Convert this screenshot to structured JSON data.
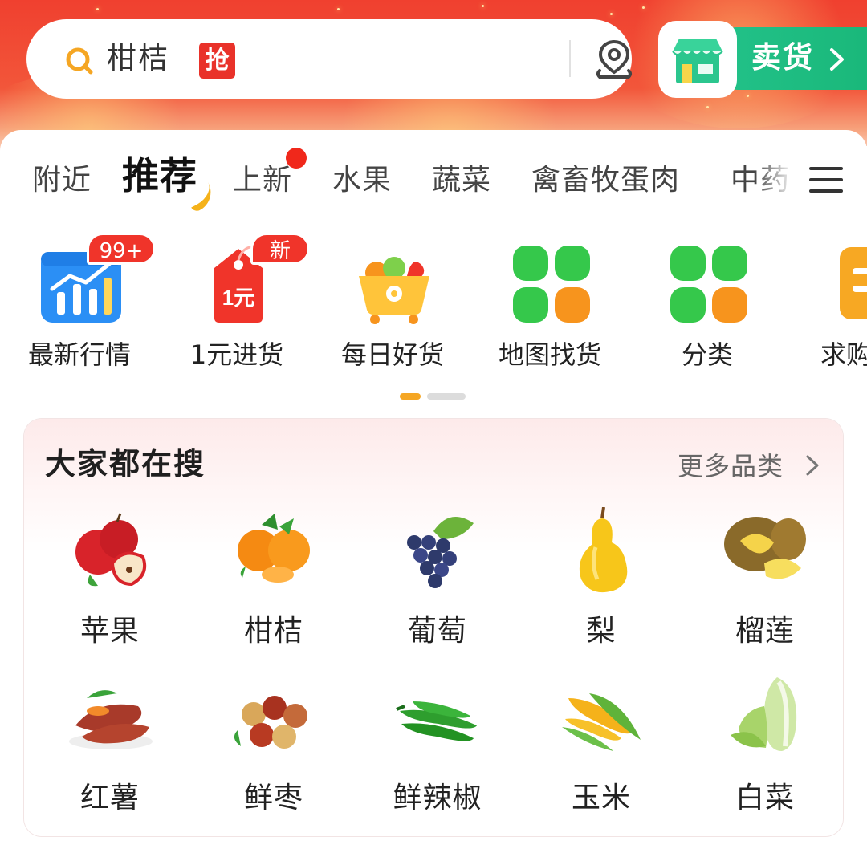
{
  "header": {
    "search": {
      "text": "柑桔",
      "badge": "抢"
    },
    "sell_button": {
      "label": "卖货"
    }
  },
  "tabs": [
    {
      "label": "附近",
      "active": false,
      "dot": false
    },
    {
      "label": "推荐",
      "active": true,
      "dot": false
    },
    {
      "label": "上新",
      "active": false,
      "dot": true
    },
    {
      "label": "水果",
      "active": false,
      "dot": false
    },
    {
      "label": "蔬菜",
      "active": false,
      "dot": false
    },
    {
      "label": "禽畜牧蛋肉",
      "active": false,
      "dot": false
    },
    {
      "label": "中药",
      "active": false,
      "dot": false
    }
  ],
  "quick_links": [
    {
      "label": "最新行情",
      "badge": "99+",
      "icon": "chart-icon"
    },
    {
      "label": "1元进货",
      "badge": "新",
      "icon": "price-tag-icon",
      "tag_text": "1元"
    },
    {
      "label": "每日好货",
      "badge": "",
      "icon": "produce-cart-icon"
    },
    {
      "label": "地图找货",
      "badge": "",
      "icon": "grid-icon"
    },
    {
      "label": "分类",
      "badge": "",
      "icon": "grid-icon"
    },
    {
      "label": "求购",
      "badge": "",
      "icon": "purchase-icon"
    }
  ],
  "popular": {
    "title": "大家都在搜",
    "more_label": "更多品类",
    "items": [
      {
        "label": "苹果",
        "icon": "apple-icon"
      },
      {
        "label": "柑桔",
        "icon": "tangerine-icon"
      },
      {
        "label": "葡萄",
        "icon": "grape-icon"
      },
      {
        "label": "梨",
        "icon": "pear-icon"
      },
      {
        "label": "榴莲",
        "icon": "durian-icon"
      },
      {
        "label": "红薯",
        "icon": "sweet-potato-icon"
      },
      {
        "label": "鲜枣",
        "icon": "jujube-icon"
      },
      {
        "label": "鲜辣椒",
        "icon": "chili-pepper-icon"
      },
      {
        "label": "玉米",
        "icon": "corn-icon"
      },
      {
        "label": "白菜",
        "icon": "cabbage-icon"
      }
    ]
  },
  "colors": {
    "brand_red": "#f0402f",
    "sell_green": "#1ab87a",
    "badge_red": "#f0342a",
    "tab_accent": "#f5b21a"
  }
}
